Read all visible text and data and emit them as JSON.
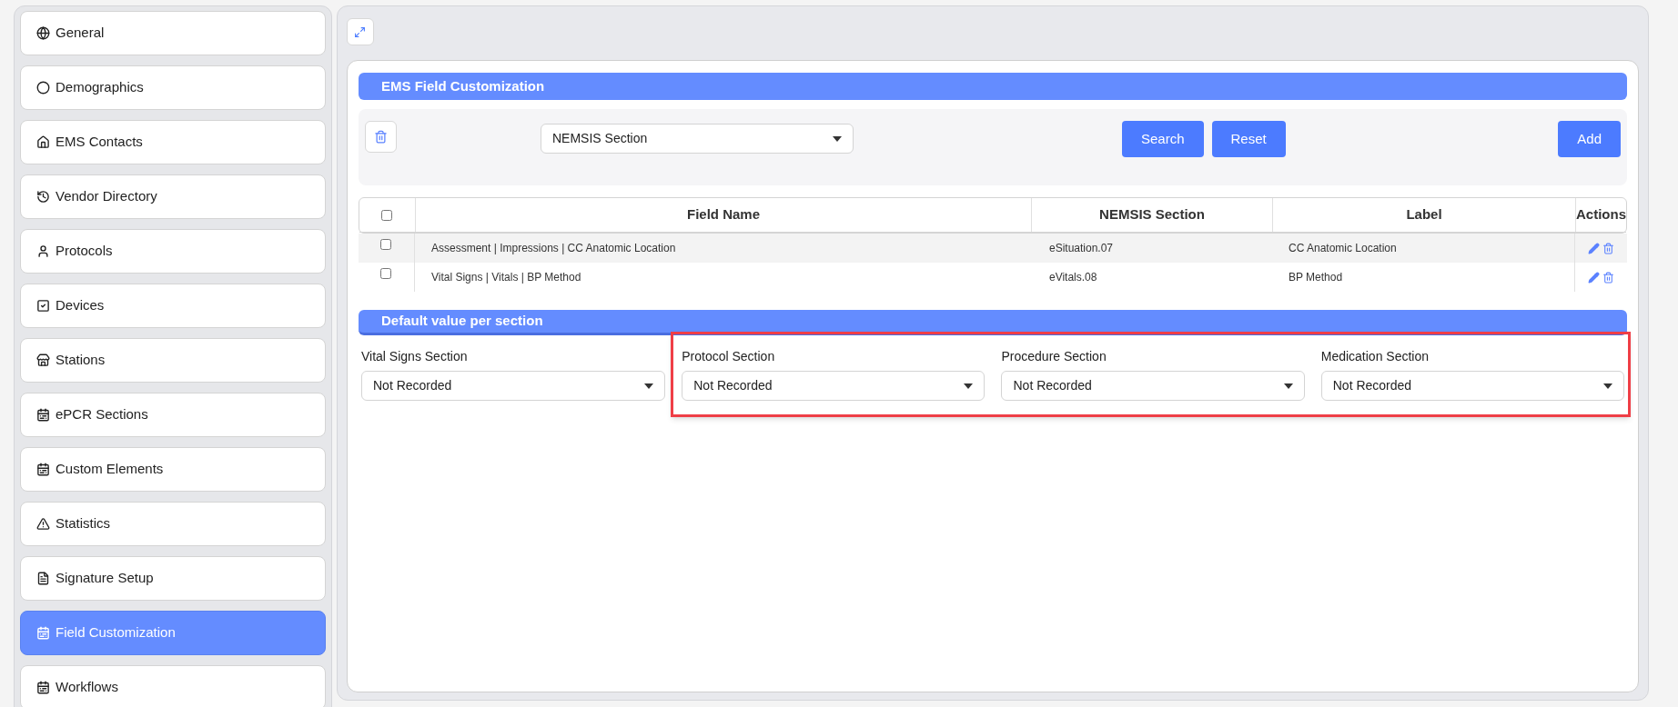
{
  "sidebar": {
    "items": [
      {
        "label": "General",
        "selected": false
      },
      {
        "label": "Demographics",
        "selected": false
      },
      {
        "label": "EMS Contacts",
        "selected": false
      },
      {
        "label": "Vendor Directory",
        "selected": false
      },
      {
        "label": "Protocols",
        "selected": false
      },
      {
        "label": "Devices",
        "selected": false
      },
      {
        "label": "Stations",
        "selected": false
      },
      {
        "label": "ePCR Sections",
        "selected": false
      },
      {
        "label": "Custom Elements",
        "selected": false
      },
      {
        "label": "Statistics",
        "selected": false
      },
      {
        "label": "Signature Setup",
        "selected": false
      },
      {
        "label": "Field Customization",
        "selected": true
      },
      {
        "label": "Workflows",
        "selected": false
      }
    ]
  },
  "customization": {
    "title": "EMS Field Customization",
    "filter": {
      "value": "NEMSIS Section"
    },
    "buttons": [
      "Search",
      "Reset"
    ],
    "add_button": "Add",
    "table": {
      "select_all_checked": false,
      "columns": [
        "Field Name",
        "NEMSIS Section",
        "Label",
        "Actions"
      ],
      "rows": [
        {
          "checked": false,
          "cells": [
            "Assessment | Impressions | CC Anatomic Location",
            "eSituation.07",
            "CC Anatomic Location"
          ]
        },
        {
          "checked": false,
          "cells": [
            "Vital Signs | Vitals | BP Method",
            "eVitals.08",
            "BP Method"
          ]
        }
      ]
    }
  },
  "defaults": {
    "title": "Default value per section",
    "fields": [
      {
        "label": "Vital Signs Section",
        "value": "Not Recorded"
      }
    ],
    "highlighted_fields": [
      {
        "label": "Protocol Section",
        "value": "Not Recorded"
      },
      {
        "label": "Procedure Section",
        "value": "Not Recorded"
      },
      {
        "label": "Medication Section",
        "value": "Not Recorded"
      }
    ]
  }
}
